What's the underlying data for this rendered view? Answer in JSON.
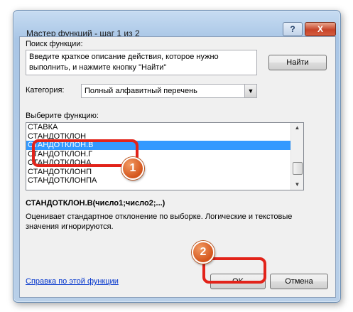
{
  "window": {
    "title": "Мастер функций - шаг 1 из 2",
    "help_symbol": "?",
    "close_symbol": "X"
  },
  "search": {
    "label": "Поиск функции:",
    "value": "Введите краткое описание действия, которое нужно выполнить, и нажмите кнопку \"Найти\"",
    "find_button": "Найти"
  },
  "category": {
    "label": "Категория:",
    "selected": "Полный алфавитный перечень"
  },
  "function_list": {
    "label": "Выберите функцию:",
    "items": [
      "СТАВКА",
      "СТАНДОТКЛОН",
      "СТАНДОТКЛОН.В",
      "СТАНДОТКЛОН.Г",
      "СТАНДОТКЛОНА",
      "СТАНДОТКЛОНП",
      "СТАНДОТКЛОНПА"
    ],
    "selected_index": 2
  },
  "details": {
    "signature": "СТАНДОТКЛОН.В(число1;число2;...)",
    "description": "Оценивает стандартное отклонение по выборке. Логические и текстовые значения игнорируются."
  },
  "footer": {
    "help_link": "Справка по этой функции",
    "ok_button": "OK",
    "cancel_button": "Отмена"
  },
  "markers": [
    "1",
    "2"
  ],
  "colors": {
    "highlight": "#e2231a",
    "marker": "#d4561d",
    "selection": "#3399ff"
  }
}
